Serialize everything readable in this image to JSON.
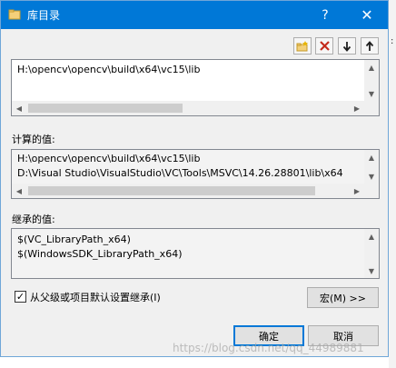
{
  "window": {
    "title": "库目录",
    "help_label": "?",
    "close_label": "✕"
  },
  "toolbar": {
    "buttons": [
      {
        "name": "new-line-icon"
      },
      {
        "name": "delete-icon"
      },
      {
        "name": "move-down-icon"
      },
      {
        "name": "move-up-icon"
      }
    ]
  },
  "editor": {
    "lines": [
      "H:\\opencv\\opencv\\build\\x64\\vc15\\lib"
    ]
  },
  "computed": {
    "label": "计算的值:",
    "lines": [
      "H:\\opencv\\opencv\\build\\x64\\vc15\\lib",
      "D:\\Visual Studio\\VisualStudio\\VC\\Tools\\MSVC\\14.26.28801\\lib\\x64"
    ]
  },
  "inherited": {
    "label": "继承的值:",
    "lines": [
      "$(VC_LibraryPath_x64)",
      "$(WindowsSDK_LibraryPath_x64)"
    ]
  },
  "inherit_checkbox": {
    "label": "从父级或项目默认设置继承(I)",
    "checked": true,
    "mark": "✓"
  },
  "buttons": {
    "macro": "宏(M) >>",
    "ok": "确定",
    "cancel": "取消"
  },
  "watermark": "https://blog.csdn.net/qq_44989881",
  "colors": {
    "titlebar": "#0078d7",
    "dialog_bg": "#f0f0f0",
    "delete_red": "#c42b1c"
  }
}
